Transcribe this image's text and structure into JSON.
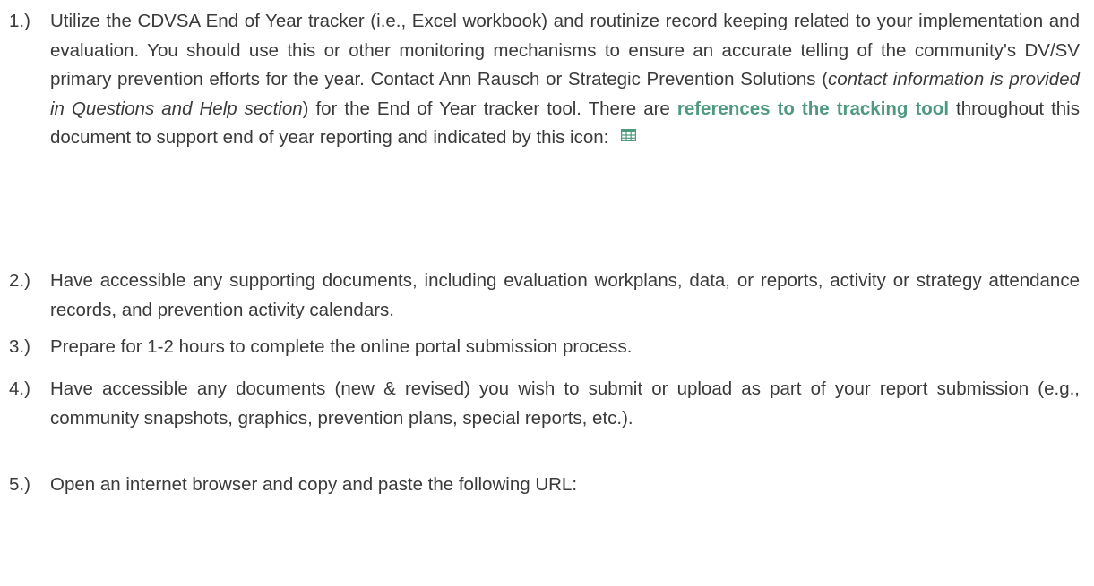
{
  "items": [
    {
      "num": "1.)",
      "text_a": "Utilize the CDVSA End of Year tracker (i.e., Excel workbook) and routinize record keeping related to your implementation and evaluation. You should use this or other monitoring mechanisms to ensure an accurate telling of the community's DV/SV primary prevention efforts for the year. Contact Ann Rausch or Strategic Prevention Solutions (",
      "text_italic": "contact information is provided in Questions and Help section",
      "text_b": ") for the End of Year tracker tool. There are ",
      "text_highlight": "references to the tracking tool",
      "text_c": " throughout this document to support end of year reporting and indicated by this icon:"
    },
    {
      "num": "2.)",
      "text": "Have accessible any supporting documents, including evaluation workplans, data, or reports, activity or strategy attendance records, and prevention activity calendars."
    },
    {
      "num": "3.)",
      "text": "Prepare for 1-2 hours to complete the online portal submission process."
    },
    {
      "num": "4.)",
      "text": "Have accessible any documents (new & revised) you wish to submit or upload as part of your report submission (e.g., community snapshots, graphics, prevention plans, special reports, etc.)."
    },
    {
      "num": "5.)",
      "text": "Open an internet browser and copy and paste the following URL:"
    }
  ],
  "icon": "spreadsheet-grid-icon",
  "colors": {
    "text": "#3a3a3a",
    "accent": "#4f9a7f"
  }
}
